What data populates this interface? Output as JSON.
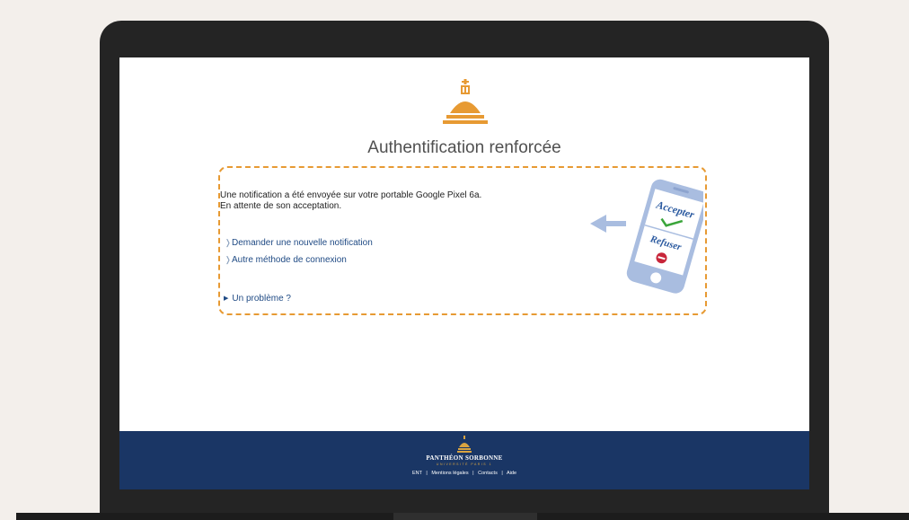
{
  "page": {
    "title": "Authentification renforcée"
  },
  "auth": {
    "message_line1": "Une notification a été envoyée sur votre portable Google Pixel 6a.",
    "message_line2": "En attente de son acceptation.",
    "links": [
      {
        "label": "Demander une nouvelle notification"
      },
      {
        "label": "Autre méthode de connexion"
      }
    ],
    "problem_label": "Un problème ?"
  },
  "phone_illustration": {
    "accept_label": "Accepter",
    "refuse_label": "Refuser"
  },
  "footer": {
    "brand": "PANTHÉON SORBONNE",
    "brand_sub": "UNIVERSITÉ PARIS 1",
    "links": [
      "ENT",
      "Mentions légales",
      "Contacts",
      "Aide"
    ],
    "separator": "|"
  },
  "colors": {
    "accent_orange": "#e79a33",
    "footer_navy": "#1a3665",
    "link_blue": "#1f4a84",
    "phone_blue": "#a9bde0"
  }
}
